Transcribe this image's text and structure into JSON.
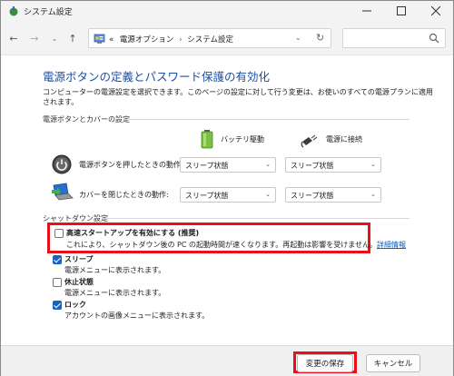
{
  "window": {
    "title": "システム設定"
  },
  "nav": {
    "back": "←",
    "forward": "→",
    "recent": "⌄",
    "up": "↑",
    "breadcrumb_prefix": "«",
    "breadcrumb_1": "電源オプション",
    "breadcrumb_sep": "›",
    "breadcrumb_2": "システム設定",
    "dropdown": "⌄",
    "refresh": "↻"
  },
  "page": {
    "title": "電源ボタンの定義とパスワード保護の有効化",
    "description": "コンピューターの電源設定を選択できます。このページの設定に対して行う変更は、お使いのすべての電源プランに適用されます。"
  },
  "power_section": {
    "label": "電源ボタンとカバーの設定",
    "col_battery": "バッテリ駆動",
    "col_plugged": "電源に接続",
    "rows": [
      {
        "label": "電源ボタンを押したときの動作:",
        "battery": "スリープ状態",
        "plugged": "スリープ状態"
      },
      {
        "label": "カバーを閉じたときの動作:",
        "battery": "スリープ状態",
        "plugged": "スリープ状態"
      }
    ]
  },
  "shutdown_section": {
    "label": "シャットダウン設定",
    "options": [
      {
        "title": "高速スタートアップを有効にする (推奨)",
        "desc": "これにより、シャットダウン後の PC の起動時間が速くなります。再起動は影響を受けません。",
        "link": "詳細情報",
        "checked": false
      },
      {
        "title": "スリープ",
        "desc": "電源メニューに表示されます。",
        "checked": true
      },
      {
        "title": "休止状態",
        "desc": "電源メニューに表示されます。",
        "checked": false
      },
      {
        "title": "ロック",
        "desc": "アカウントの画像メニューに表示されます。",
        "checked": true
      }
    ]
  },
  "buttons": {
    "save": "変更の保存",
    "cancel": "キャンセル"
  },
  "colors": {
    "title_blue": "#1e4fa5",
    "highlight_red": "#e8111b",
    "check_blue": "#1565c0"
  }
}
